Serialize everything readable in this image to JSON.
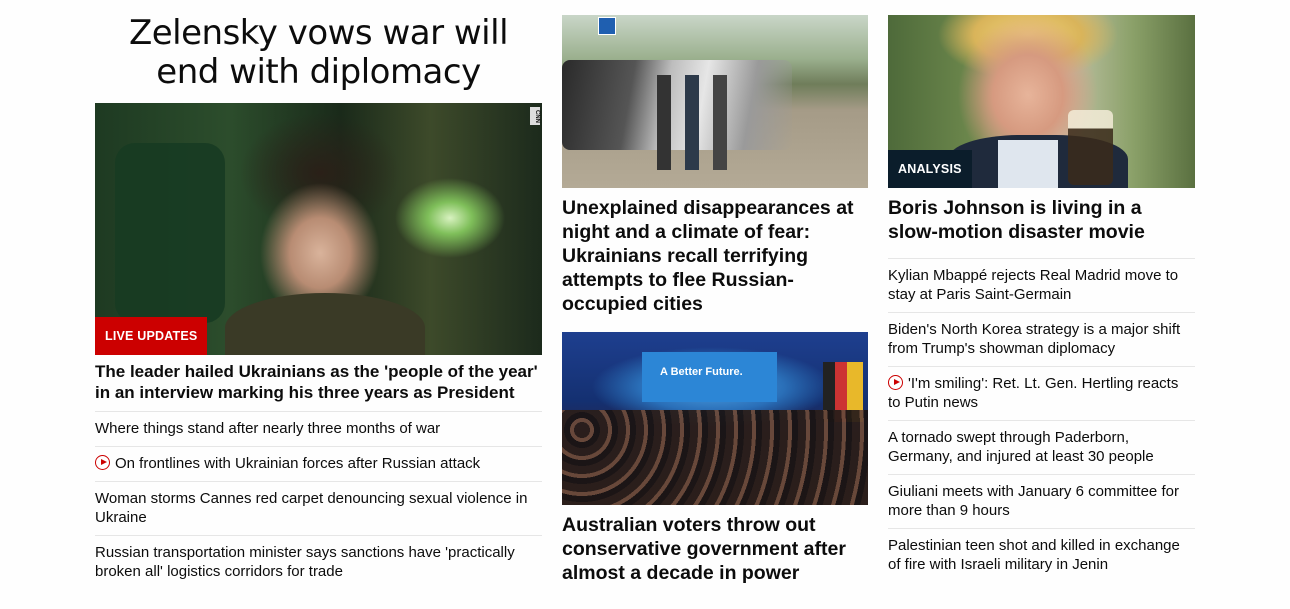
{
  "left": {
    "headline": "Zelensky vows war will end with diplomacy",
    "badge": "LIVE UPDATES",
    "lede": "The leader hailed Ukrainians as the 'people of the year' in an interview marking his three years as President",
    "links": [
      {
        "text": "Where things stand after nearly three months of war",
        "video": false
      },
      {
        "text": "On frontlines with Ukrainian forces after Russian attack",
        "video": true
      },
      {
        "text": "Woman storms Cannes red carpet denouncing sexual violence in Ukraine",
        "video": false
      },
      {
        "text": "Russian transportation minister says sanctions have 'practically broken all' logistics corridors for trade",
        "video": false
      }
    ],
    "image_watermark": "CNN"
  },
  "middle": {
    "story1_title": "Unexplained disappearances at night and a climate of fear: Ukrainians recall terrifying attempts to flee Russian-occupied cities",
    "story2_title": "Australian voters throw out conservative government after almost a decade in power",
    "rally_screen_text": "A Better Future."
  },
  "right": {
    "badge": "ANALYSIS",
    "title": "Boris Johnson is living in a slow-motion disaster movie",
    "links": [
      {
        "text": "Kylian Mbappé rejects Real Madrid move to stay at Paris Saint-Germain",
        "video": false
      },
      {
        "text": "Biden's North Korea strategy is a major shift from Trump's showman diplomacy",
        "video": false
      },
      {
        "text": "'I'm smiling': Ret. Lt. Gen. Hertling reacts to Putin news",
        "video": true
      },
      {
        "text": "A tornado swept through Paderborn, Germany, and injured at least 30 people",
        "video": false
      },
      {
        "text": "Giuliani meets with January 6 committee for more than 9 hours",
        "video": false
      },
      {
        "text": "Palestinian teen shot and killed in exchange of fire with Israeli military in Jenin",
        "video": false
      }
    ]
  },
  "colors": {
    "live_badge": "#cc0000",
    "analysis_badge": "#0b1d2b",
    "play_icon": "#cc0000"
  }
}
